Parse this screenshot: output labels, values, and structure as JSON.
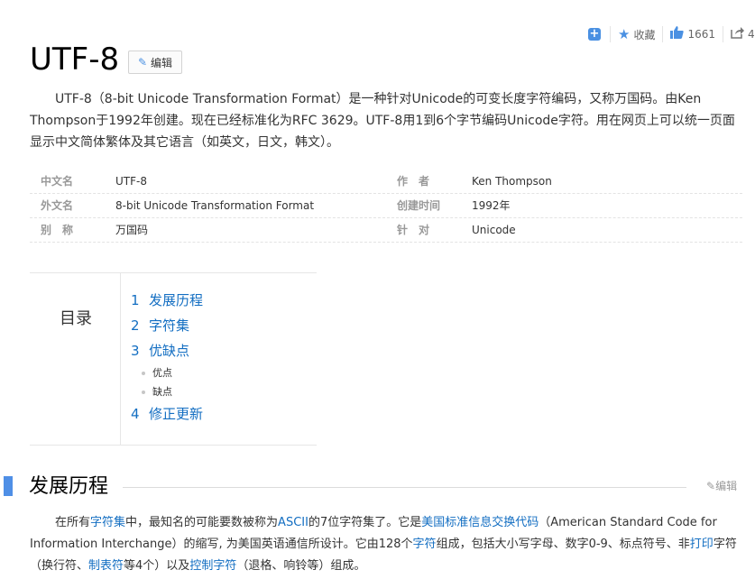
{
  "toolbar": {
    "collect_label": "收藏",
    "like_count": "1661",
    "share_count": "4"
  },
  "title": "UTF-8",
  "edit_label": "编辑",
  "summary": "UTF-8（8-bit Unicode Transformation Format）是一种针对Unicode的可变长度字符编码，又称万国码。由Ken Thompson于1992年创建。现在已经标准化为RFC 3629。UTF-8用1到6个字节编码Unicode字符。用在网页上可以统一页面显示中文简体繁体及其它语言（如英文，日文，韩文）。",
  "info": {
    "rows": [
      {
        "l1": "中文名",
        "v1": "UTF-8",
        "l2": "作　者",
        "v2": "Ken Thompson"
      },
      {
        "l1": "外文名",
        "v1": "8-bit Unicode Transformation Format",
        "l2": "创建时间",
        "v2": "1992年"
      },
      {
        "l1": "别　称",
        "v1": "万国码",
        "l2": "针　对",
        "v2": "Unicode"
      }
    ]
  },
  "toc": {
    "heading": "目录",
    "items": [
      {
        "num": "1",
        "label": "发展历程"
      },
      {
        "num": "2",
        "label": "字符集"
      },
      {
        "num": "3",
        "label": "优缺点"
      },
      {
        "sub": "优点"
      },
      {
        "sub": "缺点"
      },
      {
        "num": "4",
        "label": "修正更新"
      }
    ]
  },
  "section": {
    "title": "发展历程",
    "edit_label": "编辑",
    "para_parts": [
      {
        "t": "在所有"
      },
      {
        "t": "字符集",
        "link": true
      },
      {
        "t": "中，最知名的可能要数被称为"
      },
      {
        "t": "ASCII",
        "link": true
      },
      {
        "t": "的7位字符集了。它是"
      },
      {
        "t": "美国标准信息交换代码",
        "link": true
      },
      {
        "t": "（American Standard Code for Information Interchange）的缩写, 为美国英语通信所设计。它由128个"
      },
      {
        "t": "字符",
        "link": true
      },
      {
        "t": "组成，包括大小写字母、数字0-9、标点符号、非"
      },
      {
        "t": "打印",
        "link": true
      },
      {
        "t": "字符（换行符、"
      },
      {
        "t": "制表符",
        "link": true
      },
      {
        "t": "等4个）以及"
      },
      {
        "t": "控制字符",
        "link": true
      },
      {
        "t": "（退格、响铃等）组成。"
      }
    ]
  },
  "colors": {
    "accent": "#4f8fe6",
    "link": "#136ec2"
  }
}
